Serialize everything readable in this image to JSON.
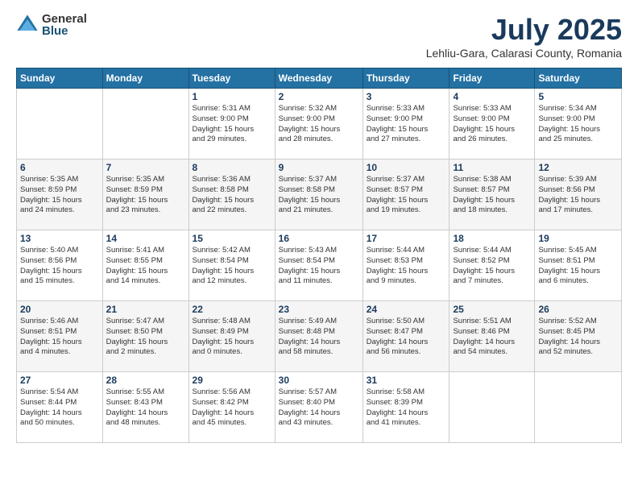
{
  "header": {
    "logo": {
      "general": "General",
      "blue": "Blue"
    },
    "title": "July 2025",
    "subtitle": "Lehliu-Gara, Calarasi County, Romania"
  },
  "weekdays": [
    "Sunday",
    "Monday",
    "Tuesday",
    "Wednesday",
    "Thursday",
    "Friday",
    "Saturday"
  ],
  "weeks": [
    [
      {
        "day": "",
        "info": ""
      },
      {
        "day": "",
        "info": ""
      },
      {
        "day": "1",
        "info": "Sunrise: 5:31 AM\nSunset: 9:00 PM\nDaylight: 15 hours\nand 29 minutes."
      },
      {
        "day": "2",
        "info": "Sunrise: 5:32 AM\nSunset: 9:00 PM\nDaylight: 15 hours\nand 28 minutes."
      },
      {
        "day": "3",
        "info": "Sunrise: 5:33 AM\nSunset: 9:00 PM\nDaylight: 15 hours\nand 27 minutes."
      },
      {
        "day": "4",
        "info": "Sunrise: 5:33 AM\nSunset: 9:00 PM\nDaylight: 15 hours\nand 26 minutes."
      },
      {
        "day": "5",
        "info": "Sunrise: 5:34 AM\nSunset: 9:00 PM\nDaylight: 15 hours\nand 25 minutes."
      }
    ],
    [
      {
        "day": "6",
        "info": "Sunrise: 5:35 AM\nSunset: 8:59 PM\nDaylight: 15 hours\nand 24 minutes."
      },
      {
        "day": "7",
        "info": "Sunrise: 5:35 AM\nSunset: 8:59 PM\nDaylight: 15 hours\nand 23 minutes."
      },
      {
        "day": "8",
        "info": "Sunrise: 5:36 AM\nSunset: 8:58 PM\nDaylight: 15 hours\nand 22 minutes."
      },
      {
        "day": "9",
        "info": "Sunrise: 5:37 AM\nSunset: 8:58 PM\nDaylight: 15 hours\nand 21 minutes."
      },
      {
        "day": "10",
        "info": "Sunrise: 5:37 AM\nSunset: 8:57 PM\nDaylight: 15 hours\nand 19 minutes."
      },
      {
        "day": "11",
        "info": "Sunrise: 5:38 AM\nSunset: 8:57 PM\nDaylight: 15 hours\nand 18 minutes."
      },
      {
        "day": "12",
        "info": "Sunrise: 5:39 AM\nSunset: 8:56 PM\nDaylight: 15 hours\nand 17 minutes."
      }
    ],
    [
      {
        "day": "13",
        "info": "Sunrise: 5:40 AM\nSunset: 8:56 PM\nDaylight: 15 hours\nand 15 minutes."
      },
      {
        "day": "14",
        "info": "Sunrise: 5:41 AM\nSunset: 8:55 PM\nDaylight: 15 hours\nand 14 minutes."
      },
      {
        "day": "15",
        "info": "Sunrise: 5:42 AM\nSunset: 8:54 PM\nDaylight: 15 hours\nand 12 minutes."
      },
      {
        "day": "16",
        "info": "Sunrise: 5:43 AM\nSunset: 8:54 PM\nDaylight: 15 hours\nand 11 minutes."
      },
      {
        "day": "17",
        "info": "Sunrise: 5:44 AM\nSunset: 8:53 PM\nDaylight: 15 hours\nand 9 minutes."
      },
      {
        "day": "18",
        "info": "Sunrise: 5:44 AM\nSunset: 8:52 PM\nDaylight: 15 hours\nand 7 minutes."
      },
      {
        "day": "19",
        "info": "Sunrise: 5:45 AM\nSunset: 8:51 PM\nDaylight: 15 hours\nand 6 minutes."
      }
    ],
    [
      {
        "day": "20",
        "info": "Sunrise: 5:46 AM\nSunset: 8:51 PM\nDaylight: 15 hours\nand 4 minutes."
      },
      {
        "day": "21",
        "info": "Sunrise: 5:47 AM\nSunset: 8:50 PM\nDaylight: 15 hours\nand 2 minutes."
      },
      {
        "day": "22",
        "info": "Sunrise: 5:48 AM\nSunset: 8:49 PM\nDaylight: 15 hours\nand 0 minutes."
      },
      {
        "day": "23",
        "info": "Sunrise: 5:49 AM\nSunset: 8:48 PM\nDaylight: 14 hours\nand 58 minutes."
      },
      {
        "day": "24",
        "info": "Sunrise: 5:50 AM\nSunset: 8:47 PM\nDaylight: 14 hours\nand 56 minutes."
      },
      {
        "day": "25",
        "info": "Sunrise: 5:51 AM\nSunset: 8:46 PM\nDaylight: 14 hours\nand 54 minutes."
      },
      {
        "day": "26",
        "info": "Sunrise: 5:52 AM\nSunset: 8:45 PM\nDaylight: 14 hours\nand 52 minutes."
      }
    ],
    [
      {
        "day": "27",
        "info": "Sunrise: 5:54 AM\nSunset: 8:44 PM\nDaylight: 14 hours\nand 50 minutes."
      },
      {
        "day": "28",
        "info": "Sunrise: 5:55 AM\nSunset: 8:43 PM\nDaylight: 14 hours\nand 48 minutes."
      },
      {
        "day": "29",
        "info": "Sunrise: 5:56 AM\nSunset: 8:42 PM\nDaylight: 14 hours\nand 45 minutes."
      },
      {
        "day": "30",
        "info": "Sunrise: 5:57 AM\nSunset: 8:40 PM\nDaylight: 14 hours\nand 43 minutes."
      },
      {
        "day": "31",
        "info": "Sunrise: 5:58 AM\nSunset: 8:39 PM\nDaylight: 14 hours\nand 41 minutes."
      },
      {
        "day": "",
        "info": ""
      },
      {
        "day": "",
        "info": ""
      }
    ]
  ]
}
